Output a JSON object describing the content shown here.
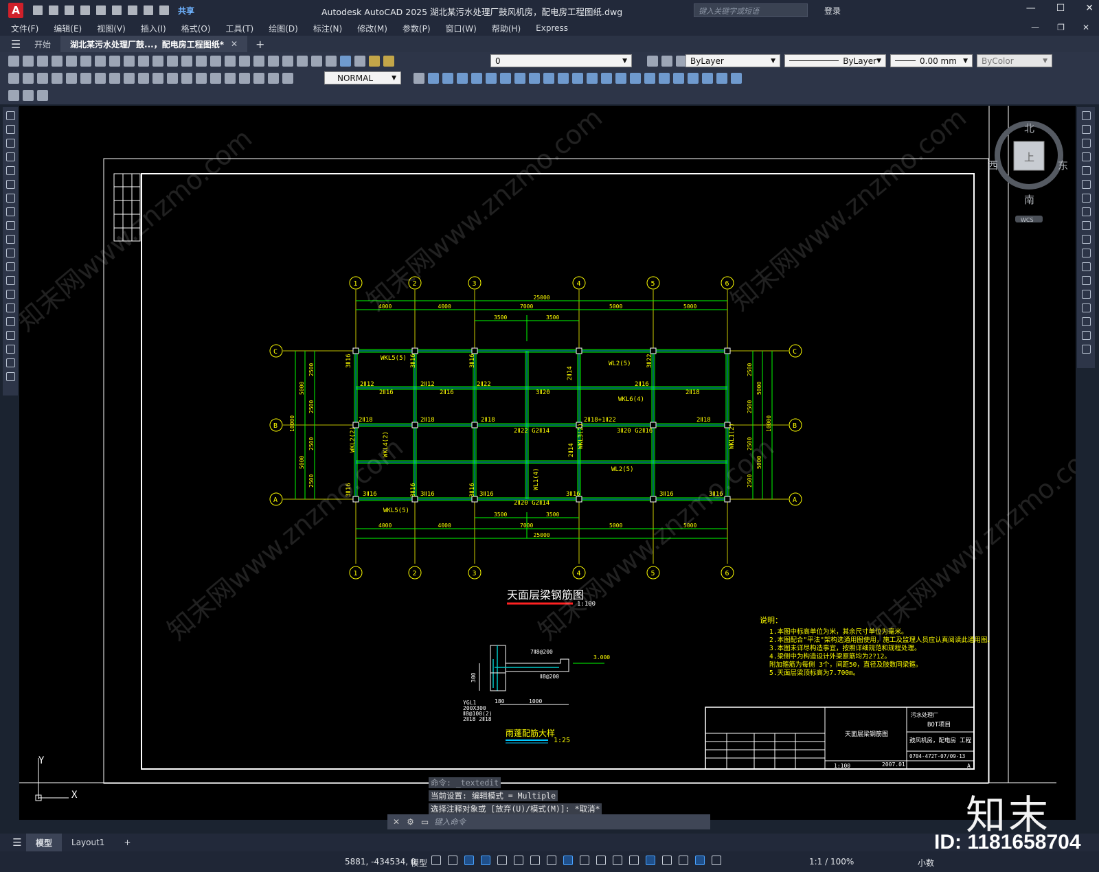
{
  "titlebar": {
    "logo": "A",
    "share": "共享",
    "title": "Autodesk AutoCAD 2025    湖北某污水处理厂鼓风机房，配电房工程图纸.dwg",
    "search_placeholder": "键入关键字或短语",
    "login": "登录"
  },
  "menu": [
    "文件(F)",
    "编辑(E)",
    "视图(V)",
    "插入(I)",
    "格式(O)",
    "工具(T)",
    "绘图(D)",
    "标注(N)",
    "修改(M)",
    "参数(P)",
    "窗口(W)",
    "帮助(H)",
    "Express"
  ],
  "tabs": {
    "start": "开始",
    "drawing": "湖北某污水处理厂鼓...，配电房工程图纸*",
    "close": "✕",
    "add": "+"
  },
  "toolbar": {
    "layer_value": "0",
    "color_value": "ByLayer",
    "linetype_value": "ByLayer",
    "lineweight_value": "0.00 mm",
    "plotstyle_value": "ByColor",
    "dimstyle_value": "NORMAL"
  },
  "compass": {
    "north": "北",
    "south": "南",
    "east": "东",
    "west": "西",
    "top": "上",
    "wcs": "WCS"
  },
  "drawing": {
    "axis_numbers": [
      "1",
      "2",
      "3",
      "4",
      "5",
      "6"
    ],
    "axis_letters": [
      "C",
      "B",
      "A"
    ],
    "total_dim": "25000",
    "bay_dims": [
      "4000",
      "4000",
      "7000",
      "5000",
      "5000"
    ],
    "half_dims": [
      "3500",
      "3500"
    ],
    "side_dims": [
      "2500",
      "2500",
      "2500",
      "2500"
    ],
    "side_half": [
      "5000",
      "5000"
    ],
    "side_total": "10000",
    "beam_labels": [
      "WKL5(5)",
      "WL2(5)",
      "WKL6(4)",
      "WL2(5)",
      "WKL3(2)",
      "WKL1(2)",
      "WKL2(2)",
      "WKL4(2)",
      "WKL5(5)",
      "WL1(4)"
    ],
    "rebar_labels": [
      "3Ⅱ16",
      "2Ⅱ12",
      "2Ⅱ16",
      "2Ⅱ22",
      "3Ⅱ20",
      "2Ⅱ18",
      "2Ⅱ14",
      "2Ⅱ16",
      "2Ⅱ18+1Ⅱ22",
      "3Ⅱ20 G2Ⅱ16",
      "2Ⅱ22 G2Ⅱ14",
      "2Ⅱ20 G2Ⅱ14",
      "3Ⅱ22",
      "2Ⅱ14"
    ],
    "plan_title": "天面层梁钢筋图",
    "plan_scale": "1:100",
    "detail_title": "雨蓬配筋大样",
    "detail_scale": "1:25",
    "detail_labels": [
      "7Ⅱ8@200",
      "Ⅱ8@200",
      "3.000",
      "300",
      "180",
      "1000",
      "YGL1",
      "200X300",
      "Ⅱ8@100(2)",
      "2Ⅱ18 2Ⅱ18"
    ],
    "notes_title": "说明：",
    "notes": [
      "1.本图中标高单位为米，其余尺寸单位为毫米。",
      "2.本图配合\"平法\"架构选通用图使用，施工及监理人员应认真阅读此通用图。",
      "3.本图未详尽构造事宜，按照详细规范和规程处理。",
      "4.梁侧中为构造设计外梁原筋均为2?12。",
      "  附加箍筋为每侧 3个，间距50，直径及肢数同梁箍。",
      "5.天面层梁顶标高为7.700m。"
    ],
    "titleblock": {
      "company": "污水处理厂",
      "project": "BOT项目",
      "sheet_name": "天面层梁钢筋图",
      "building": "鼓风机房，配电房 工程",
      "scale": "1:100",
      "date": "2007.01",
      "number": "0704-472T-07/09-13",
      "rev": "A"
    }
  },
  "ucs": {
    "y": "Y",
    "x": "X"
  },
  "command": {
    "history": [
      "命令: _textedit",
      "当前设置: 编辑模式 = Multiple",
      "选择注释对象或 [放弃(U)/模式(M)]: *取消*"
    ],
    "placeholder": "键入命令"
  },
  "layout_tabs": [
    "模型",
    "Layout1"
  ],
  "status": {
    "coords": "5881, -434534, 0",
    "mode": "模型",
    "scale": "1:1 / 100%",
    "units": "小数"
  },
  "watermark": {
    "logo": "知末",
    "id": "ID: 1181658704",
    "site": "znzmo.com",
    "site_cn": "知末网www.znzmo.com"
  }
}
